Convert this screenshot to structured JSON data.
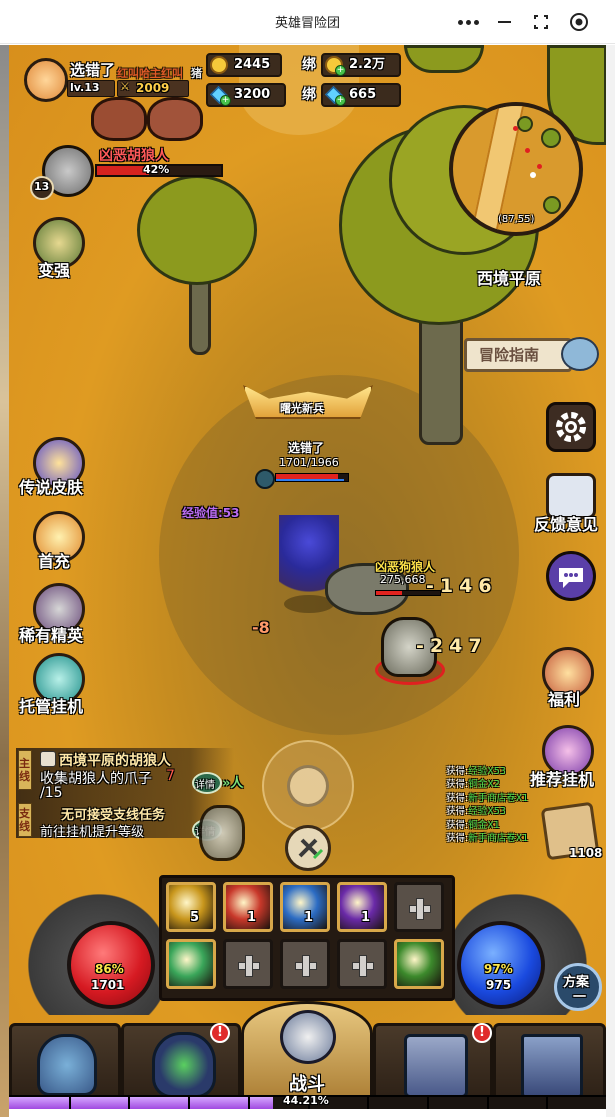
{
  "window": {
    "title": "英雄冒险团"
  },
  "player": {
    "name": "选错了",
    "level": "lv.13",
    "power": "2009",
    "overlay_text": "红叫哈主红叫"
  },
  "resources": {
    "gold": "2445",
    "bound_gold_label": "绑",
    "bound_gold": "2.2万",
    "diamond": "3200",
    "bound_diamond_label": "绑",
    "bound_diamond": "665"
  },
  "top_overlay": {
    "pig_label": "猪"
  },
  "target": {
    "name": "凶恶胡狼人",
    "hp_percent_text": "42%",
    "hp_fraction": 0.42,
    "level": "13"
  },
  "minimap": {
    "coords": "(87,55)",
    "zone_name": "西境平原"
  },
  "guide": {
    "label": "冒险指南"
  },
  "left_menu": [
    {
      "label": "变强"
    },
    {
      "label": "传说皮肤"
    },
    {
      "label": "首充"
    },
    {
      "label": "稀有精英"
    },
    {
      "label": "托管挂机"
    }
  ],
  "right_menu": [
    {
      "label": "反馈意见"
    },
    {
      "label": "福利"
    },
    {
      "label": "推荐挂机"
    }
  ],
  "hero": {
    "title_badge": "曙光新兵",
    "name": "选错了",
    "hp_text": "1701/1966",
    "hp_fraction": 0.865
  },
  "exp_text": "经验值:53",
  "enemy": {
    "name": "凶恶狗狼人",
    "hp_text": "275,668"
  },
  "damage_numbers": [
    "-146",
    "-247",
    "-8"
  ],
  "quests": {
    "main_tag": "主线",
    "main_title": "西境平原的胡狼人",
    "main_progress_prefix": "收集胡狼人的爪子",
    "main_progress_current": "7",
    "main_progress_total": "/15",
    "detail_label": "详情",
    "side_tag": "支线",
    "side_title": "无可接受支线任务",
    "side_desc": "前往挂机提升等级"
  },
  "loot_log": [
    {
      "prefix": "获得:",
      "item": "经验X53"
    },
    {
      "prefix": "获得:",
      "item": "铜金X2"
    },
    {
      "prefix": "获得:",
      "item": "新手商店卷X1"
    },
    {
      "prefix": "获得:",
      "item": "经验X53"
    },
    {
      "prefix": "获得:",
      "item": "铜金X1"
    },
    {
      "prefix": "获得:",
      "item": "新手商店卷X1"
    }
  ],
  "bag_count": "1108",
  "orbs": {
    "hp_percent": "86%",
    "hp_value": "1701",
    "mp_percent": "97%",
    "mp_value": "975"
  },
  "skills": [
    {
      "count": "5",
      "color": "#c8961c"
    },
    {
      "count": "1",
      "color": "#c8382a"
    },
    {
      "count": "1",
      "color": "#2c6cc4"
    },
    {
      "count": "1",
      "color": "#6a2aa8"
    },
    {
      "count": "",
      "color": "empty"
    },
    {
      "count": "",
      "color": "#3aa65a"
    },
    {
      "count": "",
      "color": "empty"
    },
    {
      "count": "",
      "color": "empty"
    },
    {
      "count": "",
      "color": "empty"
    },
    {
      "count": "",
      "color": "#3c8a2c"
    }
  ],
  "plan_button": {
    "line1": "方案",
    "line2": "一"
  },
  "bottom_nav": {
    "battle_label": "战斗",
    "badge": "!"
  },
  "exp_bar": {
    "percent_text": "44.21%",
    "fraction": 0.4421
  },
  "icons": {
    "settings": "gear-icon",
    "chat": "chat-bubble-icon",
    "joystick": "joystick-icon"
  }
}
